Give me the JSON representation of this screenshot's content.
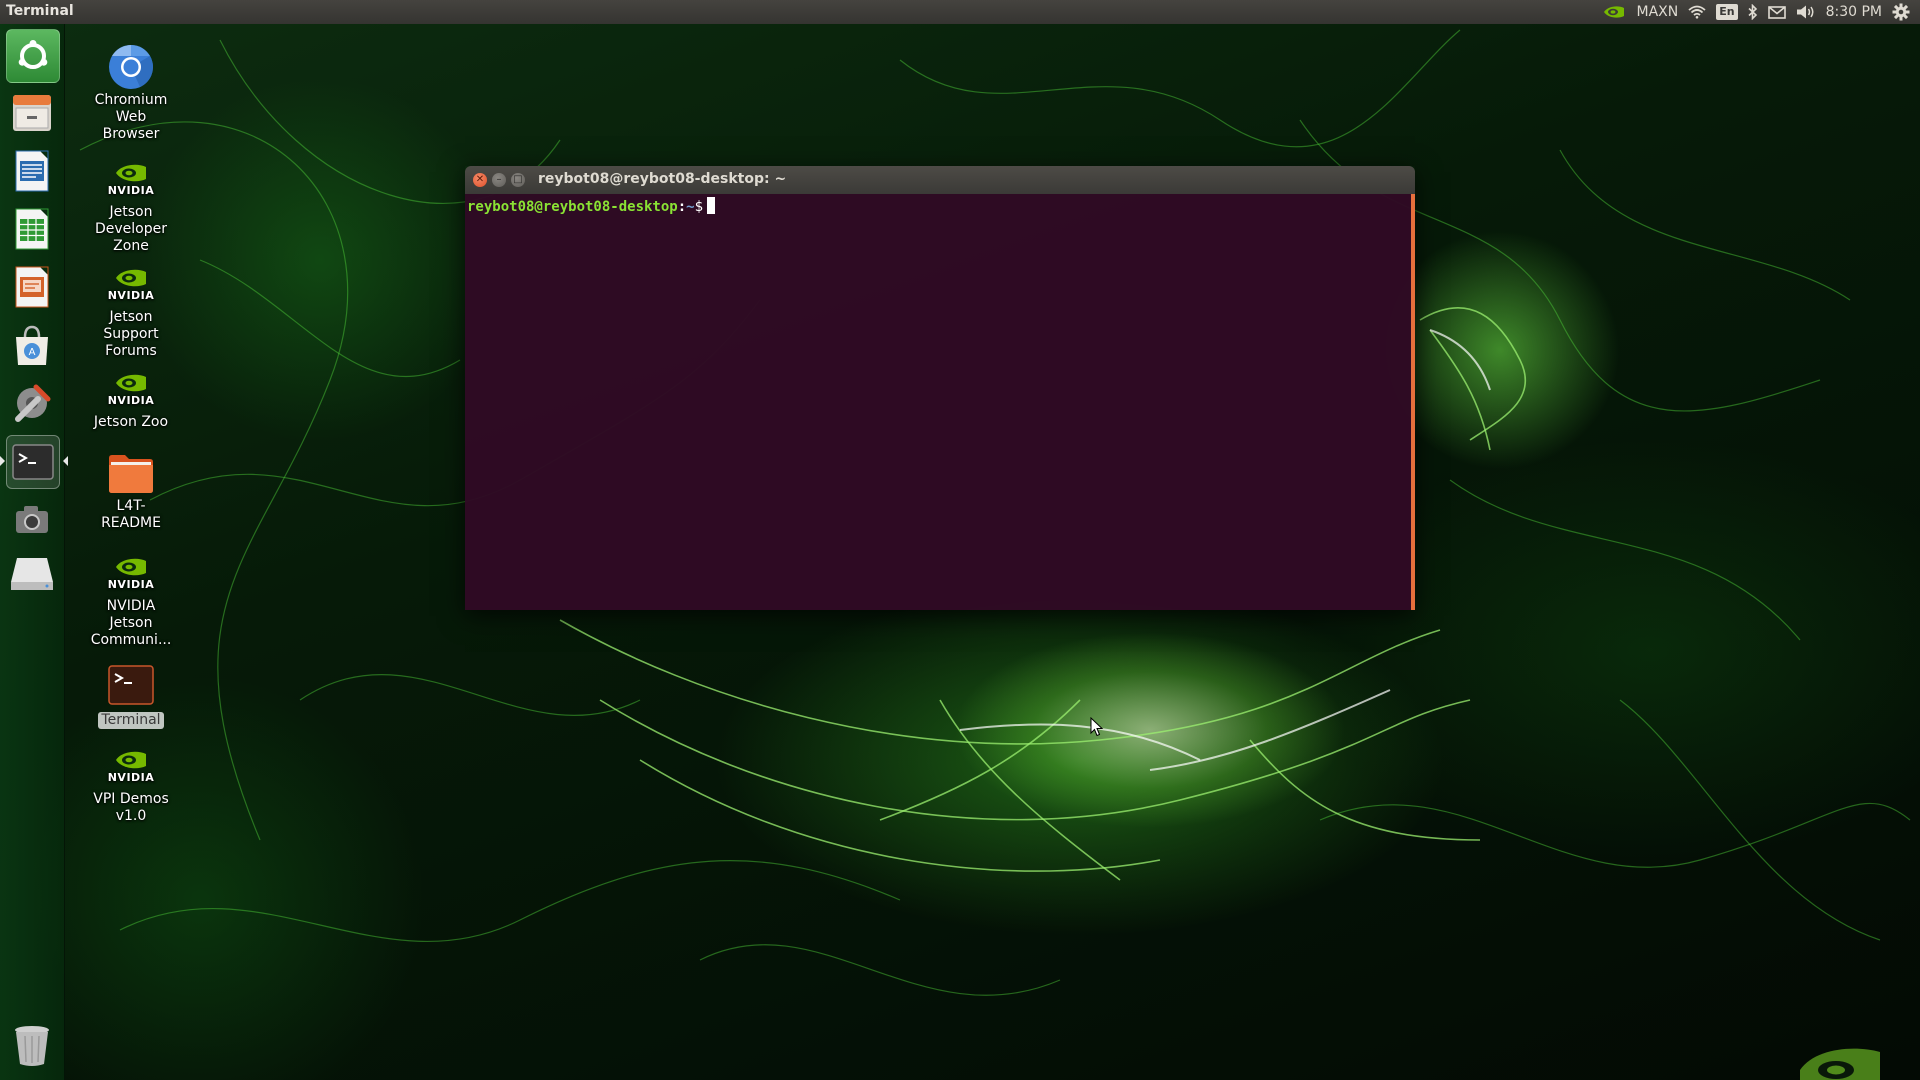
{
  "top_panel": {
    "app_title": "Terminal",
    "power_mode": "MAXN",
    "keyboard_layout": "En",
    "clock": "8:30 PM",
    "icons": [
      "nvidia-logo-icon",
      "wifi-icon",
      "bluetooth-icon",
      "mail-icon",
      "volume-icon",
      "settings-gear-icon"
    ]
  },
  "launcher": {
    "items": [
      {
        "name": "ubuntu-dash",
        "icon": "dash-icon"
      },
      {
        "name": "files",
        "icon": "file-cabinet-icon"
      },
      {
        "name": "libreoffice-writer",
        "icon": "writer-icon"
      },
      {
        "name": "libreoffice-calc",
        "icon": "calc-icon"
      },
      {
        "name": "libreoffice-impress",
        "icon": "impress-icon"
      },
      {
        "name": "software-center",
        "icon": "shopping-bag-icon"
      },
      {
        "name": "system-settings",
        "icon": "settings-icon"
      },
      {
        "name": "terminal",
        "icon": "terminal-icon",
        "active": true
      },
      {
        "name": "camera",
        "icon": "camera-icon"
      },
      {
        "name": "drive",
        "icon": "drive-icon"
      },
      {
        "name": "trash",
        "icon": "trash-icon"
      }
    ]
  },
  "desktop": {
    "icons": [
      {
        "label": "Chromium\nWeb\nBrowser",
        "icon": "chromium-icon"
      },
      {
        "label": "Jetson\nDeveloper\nZone",
        "icon": "nvidia-logo-icon",
        "logo_text": "NVIDIA"
      },
      {
        "label": "Jetson\nSupport\nForums",
        "icon": "nvidia-logo-icon",
        "logo_text": "NVIDIA"
      },
      {
        "label": "Jetson Zoo",
        "icon": "nvidia-logo-icon",
        "logo_text": "NVIDIA"
      },
      {
        "label": "L4T-\nREADME",
        "icon": "folder-icon"
      },
      {
        "label": "NVIDIA\nJetson\nCommuni...",
        "icon": "nvidia-logo-icon",
        "logo_text": "NVIDIA"
      },
      {
        "label": "Terminal",
        "icon": "terminal-icon",
        "selected": true
      },
      {
        "label": "VPI Demos\nv1.0",
        "icon": "nvidia-logo-icon",
        "logo_text": "NVIDIA"
      }
    ]
  },
  "terminal": {
    "title": "reybot08@reybot08-desktop: ~",
    "prompt_user": "reybot08@reybot08-desktop",
    "prompt_sep": ":",
    "prompt_dir": "~",
    "prompt_symbol": "$",
    "colors": {
      "background": "#300a24",
      "user": "#8ae234",
      "dir": "#729fcf",
      "scrollbar": "#e66f3c"
    }
  },
  "colors": {
    "panel": "#3c3b37",
    "launcher": "#0a3712",
    "accent": "#76b900"
  }
}
